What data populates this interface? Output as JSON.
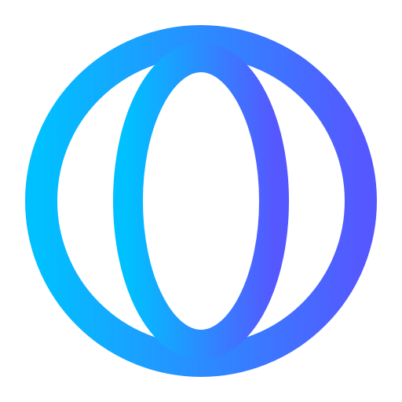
{
  "icon": {
    "name": "globe-icon",
    "gradient_start": "#00C0FF",
    "gradient_end": "#5558FF",
    "background": "#FFFFFF"
  }
}
